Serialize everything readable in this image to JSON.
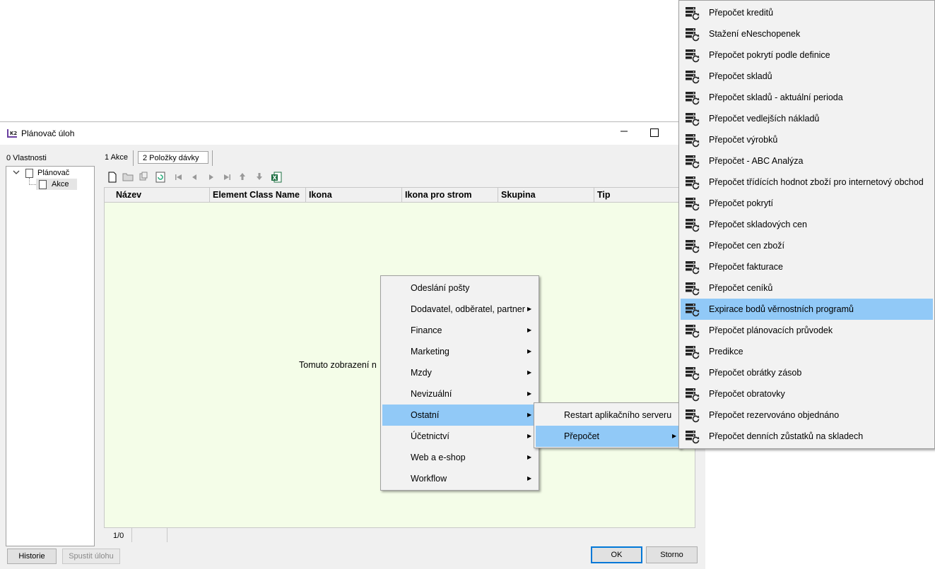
{
  "window": {
    "title": "Plánovač úloh",
    "minimize_glyph": "—"
  },
  "left_panel": {
    "tab_label": "0 Vlastnosti",
    "tree": [
      {
        "label": "Plánovač",
        "expanded": true,
        "icon": "document-icon"
      },
      {
        "label": "Akce",
        "selected": true,
        "icon": "document-icon"
      }
    ]
  },
  "tabs": [
    {
      "label": "1 Akce",
      "active": false
    },
    {
      "label": "2 Položky dávky",
      "active": true
    }
  ],
  "toolbar": {
    "icons": [
      "new-icon",
      "open-folder-icon",
      "copy-icon",
      "refresh-icon",
      "first-icon",
      "prev-icon",
      "next-icon",
      "last-icon",
      "move-up-icon",
      "move-down-icon",
      "excel-icon"
    ]
  },
  "grid": {
    "columns": [
      "Název",
      "Element Class Name",
      "Ikona",
      "Ikona pro strom",
      "Skupina",
      "Tip"
    ],
    "empty_message": "Tomuto zobrazení n",
    "background": "#f4fde8"
  },
  "status": {
    "count": "1/0"
  },
  "buttons": {
    "historie": "Historie",
    "spustit": "Spustit úlohu",
    "ok": "OK",
    "storno": "Storno"
  },
  "menu1": {
    "items": [
      {
        "label": "Odeslání pošty",
        "submenu": false
      },
      {
        "label": "Dodavatel, odběratel, partner",
        "submenu": true
      },
      {
        "label": "Finance",
        "submenu": true
      },
      {
        "label": "Marketing",
        "submenu": true
      },
      {
        "label": "Mzdy",
        "submenu": true
      },
      {
        "label": "Nevizuální",
        "submenu": true
      },
      {
        "label": "Ostatní",
        "submenu": true,
        "highlighted": true
      },
      {
        "label": "Účetnictví",
        "submenu": true
      },
      {
        "label": "Web a e-shop",
        "submenu": true
      },
      {
        "label": "Workflow",
        "submenu": true
      }
    ]
  },
  "menu2": {
    "items": [
      {
        "label": "Restart aplikačního serveru",
        "submenu": false
      },
      {
        "label": "Přepočet",
        "submenu": true,
        "highlighted": true
      }
    ]
  },
  "menu3": {
    "item_icon": "server-refresh-icon",
    "items": [
      {
        "label": "Přepočet kreditů"
      },
      {
        "label": "Stažení eNeschopenek"
      },
      {
        "label": "Přepočet pokrytí podle definice"
      },
      {
        "label": "Přepočet skladů"
      },
      {
        "label": "Přepočet skladů - aktuální perioda"
      },
      {
        "label": "Přepočet vedlejších nákladů"
      },
      {
        "label": "Přepočet výrobků"
      },
      {
        "label": "Přepočet - ABC Analýza"
      },
      {
        "label": "Přepočet třídících hodnot zboží pro internetový obchod"
      },
      {
        "label": "Přepočet pokrytí"
      },
      {
        "label": "Přepočet skladových cen"
      },
      {
        "label": "Přepočet cen zboží"
      },
      {
        "label": "Přepočet fakturace"
      },
      {
        "label": "Přepočet ceníků"
      },
      {
        "label": "Expirace bodů věrnostních programů",
        "highlighted": true
      },
      {
        "label": "Přepočet plánovacích průvodek"
      },
      {
        "label": "Predikce"
      },
      {
        "label": "Přepočet obrátky zásob"
      },
      {
        "label": "Přepočet obratovky"
      },
      {
        "label": "Přepočet rezervováno objednáno"
      },
      {
        "label": "Přepočet denních zůstatků na skladech"
      }
    ]
  },
  "colors": {
    "highlight": "#91c9f7",
    "ok_border": "#0078d7",
    "menu_bg": "#f2f2f2"
  }
}
